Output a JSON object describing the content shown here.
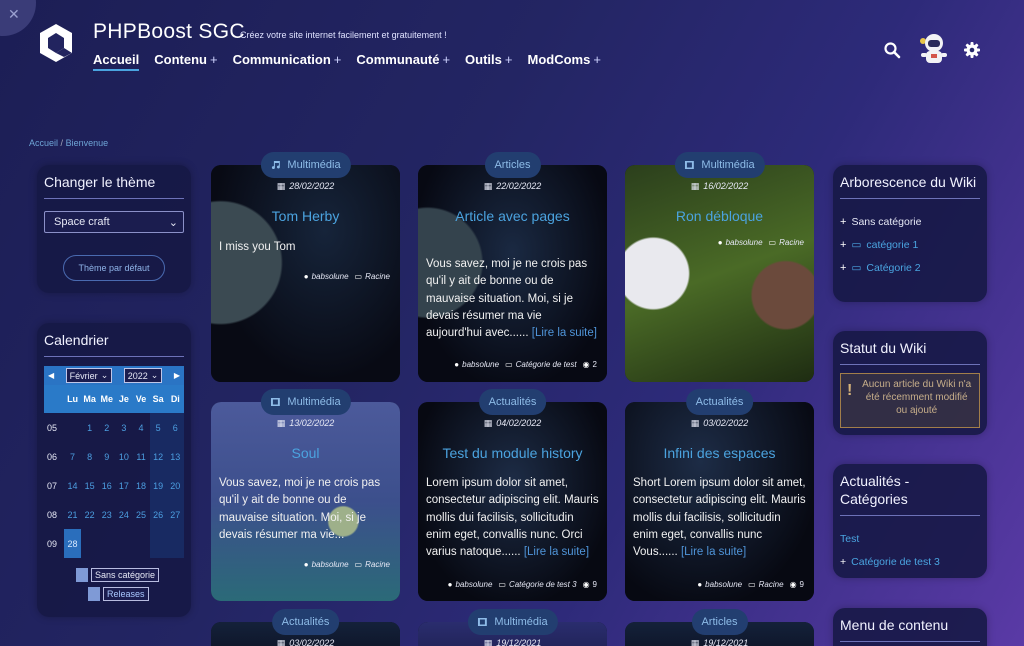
{
  "header": {
    "title": "PHPBoost SGC",
    "tagline": "Créez votre site internet facilement et gratuitement !",
    "nav": [
      {
        "label": "Accueil",
        "plus": ""
      },
      {
        "label": "Contenu",
        "plus": "+"
      },
      {
        "label": "Communication",
        "plus": "+"
      },
      {
        "label": "Communauté",
        "plus": "+"
      },
      {
        "label": "Outils",
        "plus": "+"
      },
      {
        "label": "ModComs",
        "plus": "+"
      }
    ]
  },
  "icons": {
    "search": "search-icon",
    "settings": "gear-icon",
    "avatar": "astronaut-avatar",
    "tools": "wrench-icon"
  },
  "breadcrumb": {
    "root": "Accueil",
    "sep": "/",
    "current": "Bienvenue"
  },
  "theme": {
    "title": "Changer le thème",
    "selected": "Space craft",
    "reset": "Thème par défaut"
  },
  "calendar": {
    "title": "Calendrier",
    "month": "Février",
    "year": "2022",
    "days": [
      "Lu",
      "Ma",
      "Me",
      "Je",
      "Ve",
      "Sa",
      "Di"
    ],
    "weeks": [
      {
        "week": "05",
        "days": [
          "",
          "1",
          "2",
          "3",
          "4",
          "5",
          "6"
        ],
        "events": [
          5
        ]
      },
      {
        "week": "06",
        "days": [
          "7",
          "8",
          "9",
          "10",
          "11",
          "12",
          "13"
        ],
        "events": [
          3
        ]
      },
      {
        "week": "07",
        "days": [
          "14",
          "15",
          "16",
          "17",
          "18",
          "19",
          "20"
        ],
        "events": [
          3
        ]
      },
      {
        "week": "08",
        "days": [
          "21",
          "22",
          "23",
          "24",
          "25",
          "26",
          "27"
        ],
        "events": [
          0
        ]
      },
      {
        "week": "09",
        "days": [
          "28",
          "",
          "",
          "",
          "",
          "",
          ""
        ],
        "events": []
      }
    ],
    "legend": [
      "Sans catégorie",
      "Releases"
    ]
  },
  "cards": [
    {
      "category": "Multimédia",
      "icon": "music-note-icon",
      "date": "28/02/2022",
      "title": "Tom Herby",
      "text": "I miss you Tom",
      "more": "",
      "author": "babsolune",
      "cat_link": "Racine",
      "views": ""
    },
    {
      "category": "Articles",
      "icon": "",
      "date": "22/02/2022",
      "title": "Article avec pages",
      "text": "Vous savez, moi je ne crois pas qu'il y ait de bonne ou de mauvaise situation. Moi, si je devais résumer ma vie aujourd'hui avec......",
      "more": "[Lire la suite]",
      "author": "babsolune",
      "cat_link": "Catégorie de test",
      "views": "2"
    },
    {
      "category": "Multimédia",
      "icon": "film-icon",
      "date": "16/02/2022",
      "title": "Ron débloque",
      "text": "",
      "more": "",
      "author": "babsolune",
      "cat_link": "Racine",
      "views": ""
    },
    {
      "category": "Multimédia",
      "icon": "film-icon",
      "date": "13/02/2022",
      "title": "Soul",
      "text": "Vous savez, moi je ne crois pas qu'il y ait de bonne ou de mauvaise situation. Moi, si je devais résumer ma vie...",
      "more": "",
      "author": "babsolune",
      "cat_link": "Racine",
      "views": ""
    },
    {
      "category": "Actualités",
      "icon": "",
      "date": "04/02/2022",
      "title": "Test du module history",
      "text": "Lorem ipsum dolor sit amet, consectetur adipiscing elit. Mauris mollis dui facilisis, sollicitudin enim eget, convallis nunc. Orci varius natoque......",
      "more": "[Lire la suite]",
      "author": "babsolune",
      "cat_link": "Catégorie de test 3",
      "views": "9"
    },
    {
      "category": "Actualités",
      "icon": "",
      "date": "03/02/2022",
      "title": "Infini des espaces",
      "text": "Short Lorem ipsum dolor sit amet, consectetur adipiscing elit. Mauris mollis dui facilisis, sollicitudin enim eget, convallis nunc Vous......",
      "more": "[Lire la suite]",
      "author": "babsolune",
      "cat_link": "Racine",
      "views": "9"
    },
    {
      "category": "Actualités",
      "icon": "",
      "date": "03/02/2022",
      "title": "",
      "text": "",
      "more": "",
      "author": "",
      "cat_link": "",
      "views": ""
    },
    {
      "category": "Multimédia",
      "icon": "film-icon",
      "date": "19/12/2021",
      "title": "",
      "text": "",
      "more": "",
      "author": "",
      "cat_link": "",
      "views": ""
    },
    {
      "category": "Articles",
      "icon": "",
      "date": "19/12/2021",
      "title": "",
      "text": "",
      "more": "",
      "author": "",
      "cat_link": "",
      "views": ""
    }
  ],
  "wiki_tree": {
    "title": "Arborescence du Wiki",
    "items": [
      "Sans catégorie",
      "catégorie 1",
      "Catégorie 2"
    ]
  },
  "wiki_status": {
    "title": "Statut du Wiki",
    "message": "Aucun article du Wiki n'a été récemment modifié ou ajouté"
  },
  "news_cats": {
    "title": "Actualités - Catégories",
    "items": [
      "Test",
      "Catégorie de test 3"
    ]
  },
  "content_menu": {
    "title": "Menu de contenu"
  }
}
